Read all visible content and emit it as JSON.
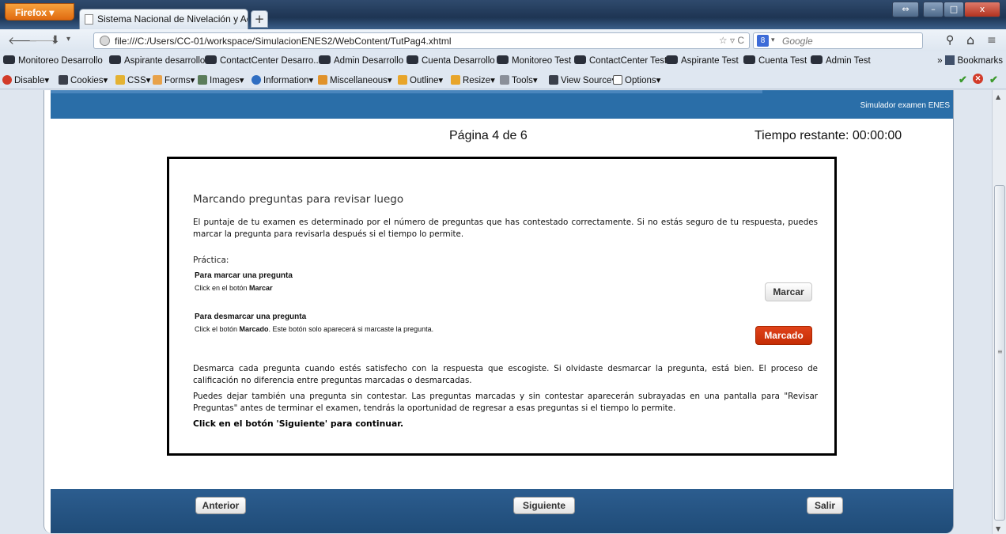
{
  "browser": {
    "menu_button": "Firefox ▾",
    "tab_title": "Sistema Nacional de Nivelación y Admis...",
    "tab_close": "×",
    "new_tab": "+",
    "window_controls": {
      "restore": "⇔",
      "minimize": "–",
      "maximize": "□",
      "close": "x"
    },
    "nav": {
      "back": "🡐",
      "forward": "🡒",
      "download": "⬇",
      "url": "file:///C:/Users/CC-01/workspace/SimulacionENES2/WebContent/TutPag4.xhtml",
      "url_controls": "☆ ▿ C",
      "search_engine": "8",
      "search_placeholder": "Google",
      "search_icon": "⚲",
      "home_icon": "⌂",
      "menu_icon": "≡"
    },
    "bookmarks": [
      "Monitoreo Desarrollo",
      "Aspirante desarrollo",
      "ContactCenter Desarro...",
      "Admin Desarrollo",
      "Cuenta Desarrollo",
      "Monitoreo Test",
      "ContactCenter Test",
      "Aspirante Test",
      "Cuenta Test",
      "Admin Test"
    ],
    "bookmarks_more": "»",
    "bookmarks_menu": "Bookmarks",
    "webdev_toolbar": [
      "Disable▾",
      "Cookies▾",
      "CSS▾",
      "Forms▾",
      "Images▾",
      "Information▾",
      "Miscellaneous▾",
      "Outline▾",
      "Resize▾",
      "Tools▾",
      "View Source▾",
      "Options▾"
    ]
  },
  "page": {
    "header_label": "Simulador examen ENES",
    "page_indicator": "Página 4 de 6",
    "timer": "Tiempo restante: 00:00:00",
    "box": {
      "title": "Marcando preguntas para revisar luego",
      "intro": "El puntaje de tu examen es determinado por el número de preguntas que has contestado correctamente. Si no estás seguro de tu respuesta, puedes marcar la pregunta para revisarla después si el tiempo lo permite.",
      "practice_label": "Práctica:",
      "mark_heading": "Para marcar una pregunta",
      "mark_text_prefix": "Click en el botón ",
      "mark_text_bold": "Marcar",
      "mark_button": "Marcar",
      "unmark_heading": "Para desmarcar una pregunta",
      "unmark_text_prefix": "Click el botón ",
      "unmark_text_bold": "Marcado",
      "unmark_text_suffix": ". Este botón solo aparecerá si marcaste la pregunta.",
      "unmark_button": "Marcado",
      "paragraph_unmark": "Desmarca cada pregunta cuando estés satisfecho con la respuesta que escogiste. Si olvidaste desmarcar la pregunta, está bien. El proceso de calificación no diferencia entre preguntas marcadas o desmarcadas.",
      "paragraph_skip": "Puedes dejar también una pregunta sin contestar. Las preguntas marcadas y sin contestar aparecerán subrayadas en una pantalla para \"Revisar Preguntas\" antes de terminar el examen, tendrás la oportunidad de regresar a esas preguntas si el tiempo lo permite.",
      "continue_instruction": "Click en el botón 'Siguiente' para continuar."
    },
    "footer": {
      "previous": "Anterior",
      "next": "Siguiente",
      "exit": "Salir"
    }
  },
  "colors": {
    "header_blue": "#2a6ea8",
    "footer_blue": "#1f4b77",
    "marked_button": "#c52d05"
  }
}
